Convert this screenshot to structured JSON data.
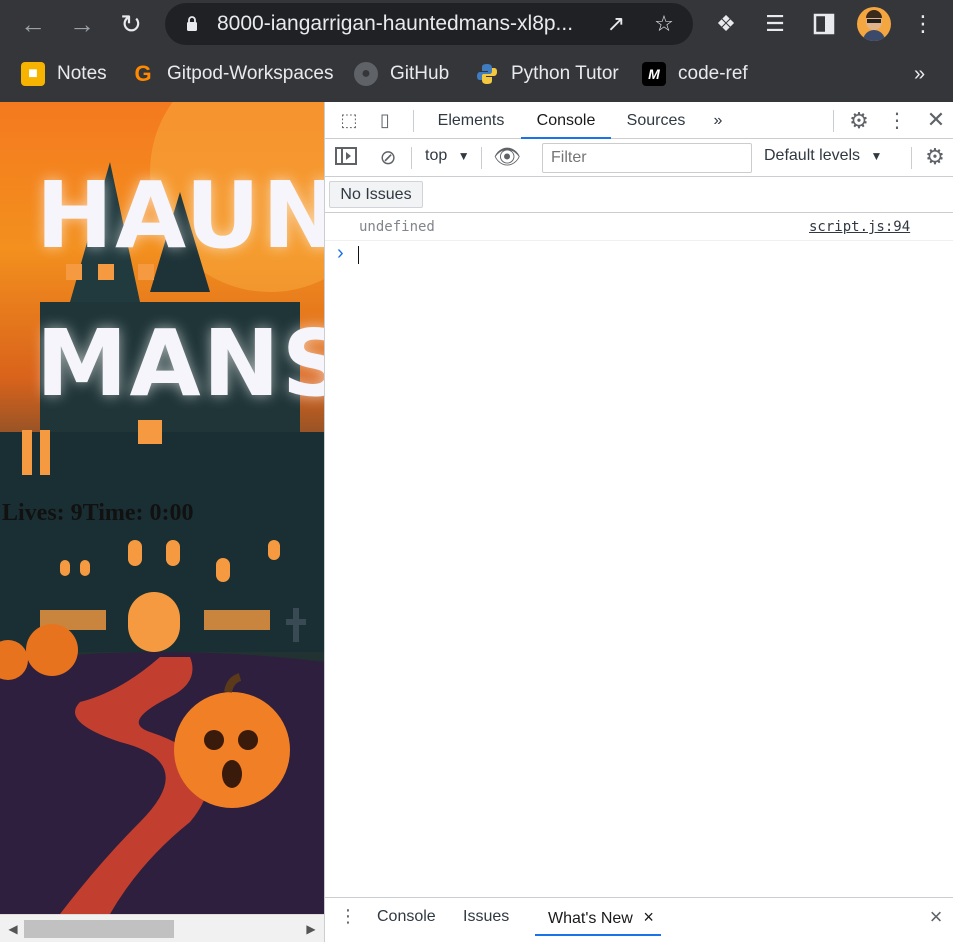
{
  "browser": {
    "url": "8000-iangarrigan-hauntedmans-xl8p...",
    "bookmarks": [
      {
        "label": "Notes",
        "icon": "notes-icon"
      },
      {
        "label": "Gitpod-Workspaces",
        "icon": "gitpod-icon"
      },
      {
        "label": "GitHub",
        "icon": "github-icon"
      },
      {
        "label": "Python Tutor",
        "icon": "python-icon"
      },
      {
        "label": "code-ref",
        "icon": "code-ref-icon"
      }
    ],
    "overflow_label": "»"
  },
  "page": {
    "title_line1": "HAUN",
    "title_line2": "MANS",
    "hud_text": "Lives: 9Time: 0:00"
  },
  "devtools": {
    "tabs": [
      "Elements",
      "Console",
      "Sources"
    ],
    "active_tab": "Console",
    "more_tabs": "»",
    "context": "top",
    "filter_placeholder": "Filter",
    "levels": "Default levels",
    "issues_button": "No Issues",
    "log": {
      "message": "undefined",
      "source": "script.js:94"
    },
    "prompt": "›",
    "drawer": {
      "tabs": [
        "Console",
        "Issues",
        "What's New"
      ],
      "active": "What's New",
      "close_tab": "×",
      "close_drawer": "×"
    }
  },
  "colors": {
    "chrome_bg": "#35363a",
    "omnibox_bg": "#202124",
    "accent": "#1a73e8"
  }
}
